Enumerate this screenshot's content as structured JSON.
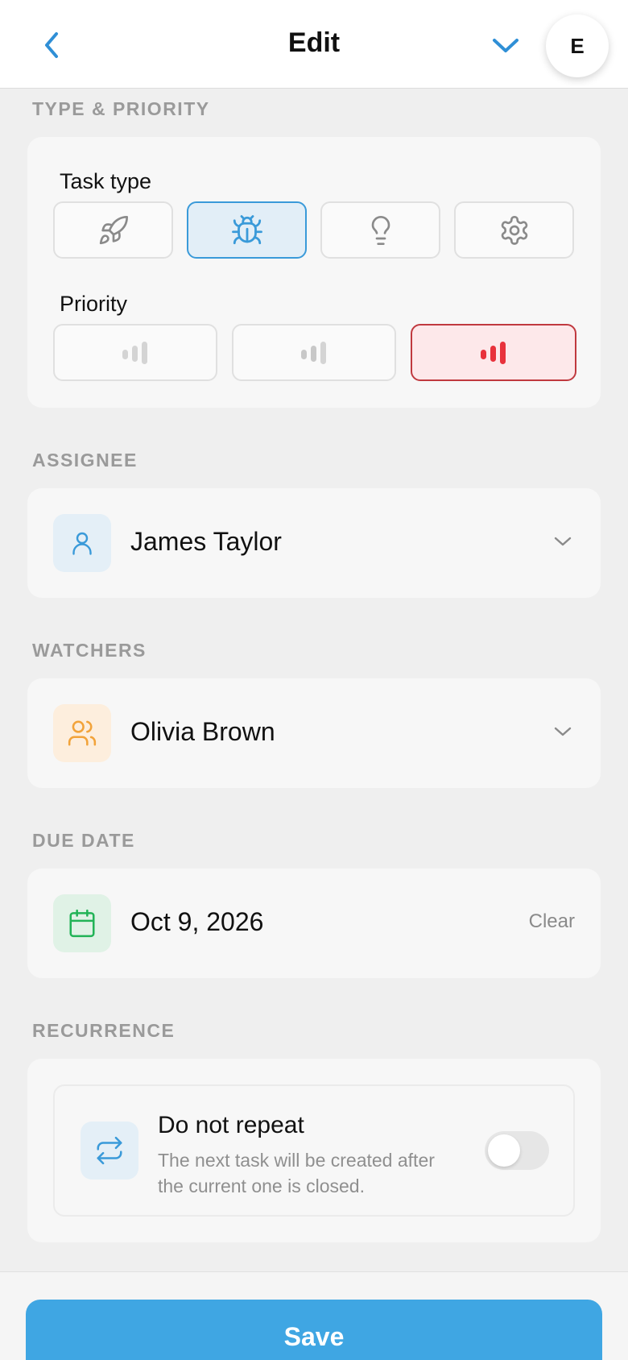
{
  "header": {
    "title": "Edit",
    "avatar_initial": "E"
  },
  "type_priority": {
    "section_label": "TYPE & PRIORITY",
    "task_type_label": "Task type",
    "task_types": [
      {
        "icon": "rocket-icon",
        "selected": false
      },
      {
        "icon": "bug-icon",
        "selected": true
      },
      {
        "icon": "lightbulb-icon",
        "selected": false
      },
      {
        "icon": "gear-icon",
        "selected": false
      }
    ],
    "priority_label": "Priority",
    "priorities": [
      {
        "icon": "priority-low-icon",
        "selected": false
      },
      {
        "icon": "priority-medium-icon",
        "selected": false
      },
      {
        "icon": "priority-high-icon",
        "selected": true
      }
    ]
  },
  "assignee": {
    "section_label": "ASSIGNEE",
    "value": "James Taylor",
    "icon": "user-icon"
  },
  "watchers": {
    "section_label": "WATCHERS",
    "value": "Olivia Brown",
    "icon": "users-icon"
  },
  "due_date": {
    "section_label": "DUE DATE",
    "value": "Oct 9, 2026",
    "clear_label": "Clear",
    "icon": "calendar-icon"
  },
  "recurrence": {
    "section_label": "RECURRENCE",
    "title": "Do not repeat",
    "description": "The next task will be created after the current one is closed.",
    "icon": "repeat-icon",
    "enabled": false
  },
  "footer": {
    "save_label": "Save"
  },
  "colors": {
    "accent": "#3fa6e3",
    "selected_type_border": "#3a9ad9",
    "priority_high": "#e8323c",
    "assignee_icon_bg": "#e4eff7",
    "watchers_icon_bg": "#fdeedd",
    "calendar_icon_bg": "#e0f2e6"
  }
}
